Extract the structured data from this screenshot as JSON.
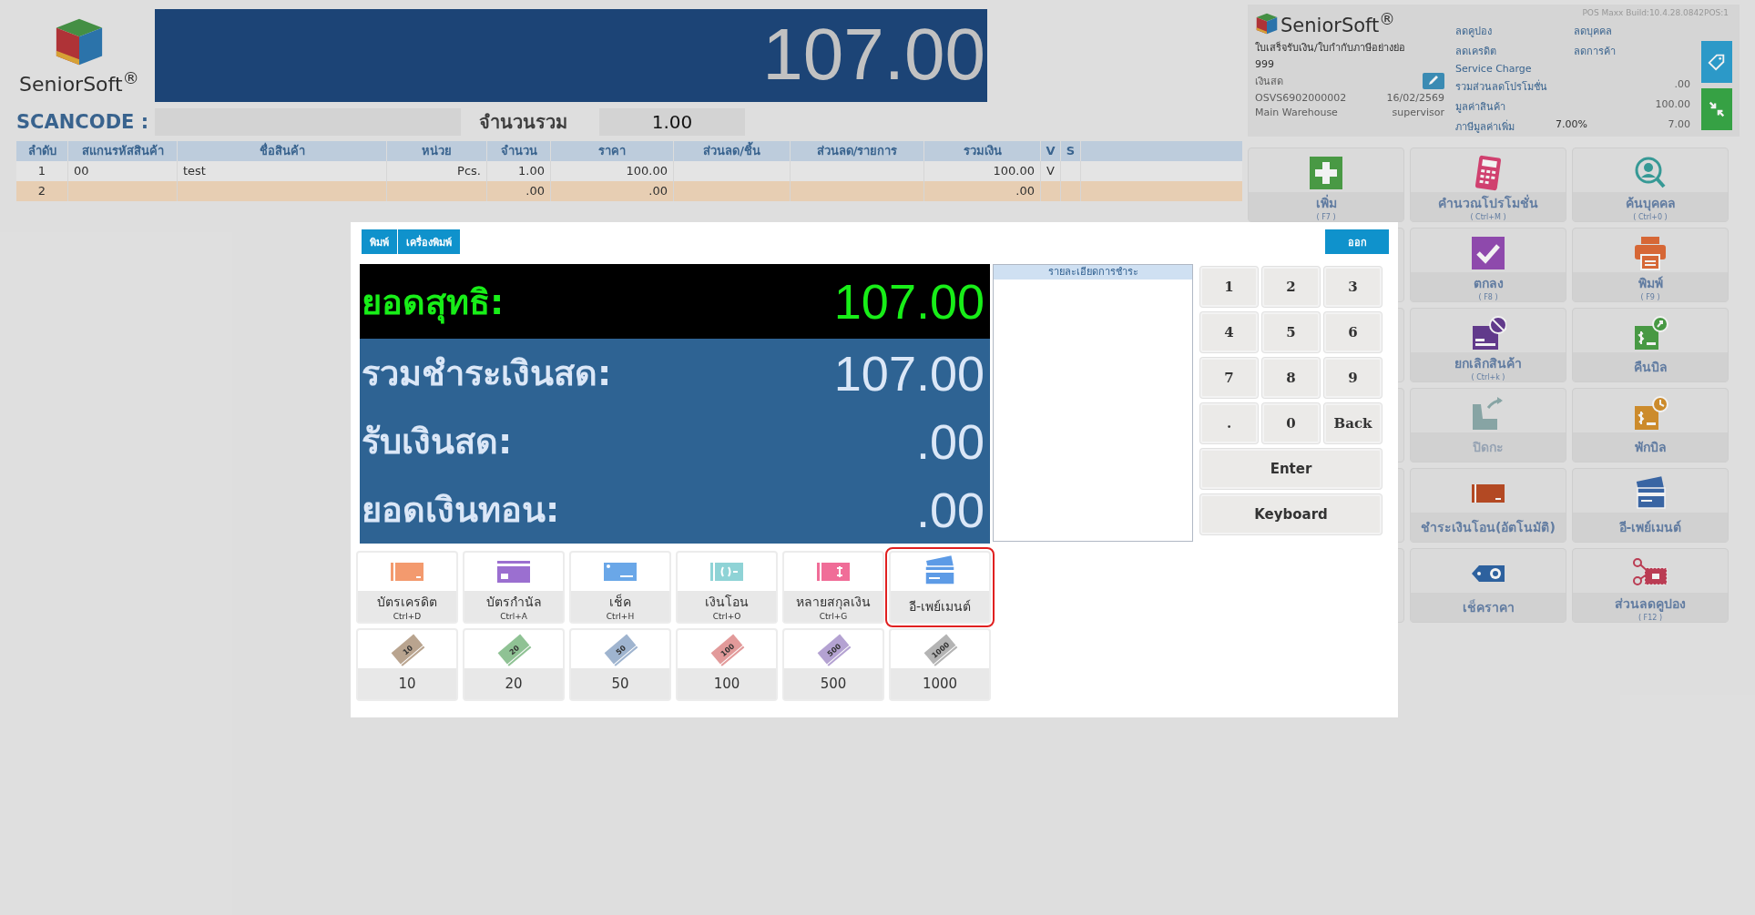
{
  "logo": {
    "name": "SeniorSoft",
    "mark": "®"
  },
  "total_display": "107.00",
  "scancode": {
    "label": "SCANCODE :"
  },
  "total_qty": {
    "label": "จำนวนรวม",
    "value": "1.00"
  },
  "table": {
    "columns": [
      "ลำดับ",
      "สแกนรหัสสินค้า",
      "ชื่อสินค้า",
      "หน่วย",
      "จำนวน",
      "ราคา",
      "ส่วนลด/ชิ้น",
      "ส่วนลด/รายการ",
      "รวมเงิน",
      "V",
      "S"
    ],
    "rows": [
      {
        "no": "1",
        "code": "00",
        "name": "test",
        "unit": "Pcs.",
        "qty": "1.00",
        "price": "100.00",
        "total": "100.00",
        "v": "V",
        "selected": false
      },
      {
        "no": "2",
        "qty": ".00",
        "price": ".00",
        "total": ".00",
        "selected": true
      }
    ]
  },
  "info": {
    "logo": {
      "name": "SeniorSoft",
      "mark": "®"
    },
    "version": "POS Maxx Build:10.4.28.0842POS:1",
    "doc_type": "ใบเสร็จรับเงิน/ใบกำกับภาษีอย่างย่อ",
    "doc_no": "999",
    "payment_type": "เงินสด",
    "bill_no": "OSVS6902000002",
    "date": "16/02/2569",
    "warehouse": "Main Warehouse",
    "user": "supervisor",
    "discount_links": [
      "ลดคูปอง",
      "ลดบุคคล",
      "ลดเครดิต",
      "ลดการค้า"
    ],
    "service_charge": "Service Charge",
    "summary": [
      {
        "label": "รวมส่วนลดโปรโมชั่น",
        "value": ".00"
      },
      {
        "label": "มูลค่าสินค้า",
        "value": "100.00"
      },
      {
        "label": "ภาษีมูลค่าเพิ่ม",
        "rate": "7.00%",
        "value": "7.00"
      }
    ]
  },
  "function_rows": [
    {
      "buttons": [
        {
          "label": "เพิ่ม",
          "shortcut": "( F7 )",
          "disabled": false
        },
        {
          "label": "คำนวณโปรโมชั่น",
          "shortcut": "( Ctrl+M )",
          "disabled": false
        },
        {
          "label": "ค้นบุคคล",
          "shortcut": "( Ctrl+0 )",
          "disabled": false
        }
      ]
    },
    {
      "buttons": [
        {
          "label": "ตกลง",
          "shortcut": "( F8 )",
          "disabled": false
        },
        {
          "label": "พิมพ์",
          "shortcut": "( F9 )",
          "disabled": false
        }
      ]
    },
    {
      "buttons": [
        {
          "label": "ยกเลิกสินค้า",
          "shortcut": "( Ctrl+k )",
          "disabled": false
        },
        {
          "label": "คืนบิล",
          "disabled": false
        }
      ]
    },
    {
      "buttons": [
        {
          "label": "ปิดกะ",
          "disabled": true
        },
        {
          "label": "พักบิล",
          "disabled": false
        }
      ]
    },
    {
      "buttons": [
        {
          "label": "ชำระเงินโอน(อัตโนมัติ)",
          "disabled": false
        },
        {
          "label": "อี-เพย์เมนต์",
          "disabled": false
        }
      ]
    },
    {
      "buttons": [
        {
          "label": "เช็คราคา",
          "disabled": false
        },
        {
          "label": "ส่วนลดคูปอง",
          "shortcut": "( F12 )",
          "disabled": false
        }
      ]
    }
  ],
  "payment_dialog": {
    "print_buttons": [
      "พิมพ์",
      "เครื่องพิมพ์"
    ],
    "exit_button": "ออก",
    "amounts": [
      {
        "kind": "net",
        "label": "ยอดสุทธิ:",
        "value": "107.00"
      },
      {
        "kind": "amount",
        "label": "รวมชำระเงินสด:",
        "value": "107.00"
      },
      {
        "kind": "amount",
        "label": "รับเงินสด:",
        "value": ".00"
      },
      {
        "kind": "amount",
        "label": "ยอดเงินทอน:",
        "value": ".00"
      }
    ],
    "detail_title": "รายละเอียดการชำระ",
    "keys": [
      "1",
      "2",
      "3",
      "4",
      "5",
      "6",
      "7",
      "8",
      "9",
      ".",
      "0",
      "Back"
    ],
    "wide_keys": [
      "Enter",
      "Keyboard"
    ],
    "payment_methods": [
      {
        "label": "บัตรเครดิต",
        "shortcut": "Ctrl+D",
        "selected": false
      },
      {
        "label": "บัตรกำนัล",
        "shortcut": "Ctrl+A",
        "selected": false
      },
      {
        "label": "เช็ค",
        "shortcut": "Ctrl+H",
        "selected": false
      },
      {
        "label": "เงินโอน",
        "shortcut": "Ctrl+O",
        "selected": false
      },
      {
        "label": "หลายสกุลเงิน",
        "shortcut": "Ctrl+G",
        "selected": false
      },
      {
        "label": "อี-เพย์เมนต์",
        "selected": true
      }
    ],
    "denominations": [
      {
        "note": "10",
        "label": "10"
      },
      {
        "note": "20",
        "label": "20"
      },
      {
        "note": "50",
        "label": "50"
      },
      {
        "note": "100",
        "label": "100"
      },
      {
        "note": "500",
        "label": "500"
      },
      {
        "note": "1000",
        "label": "1000"
      }
    ]
  }
}
